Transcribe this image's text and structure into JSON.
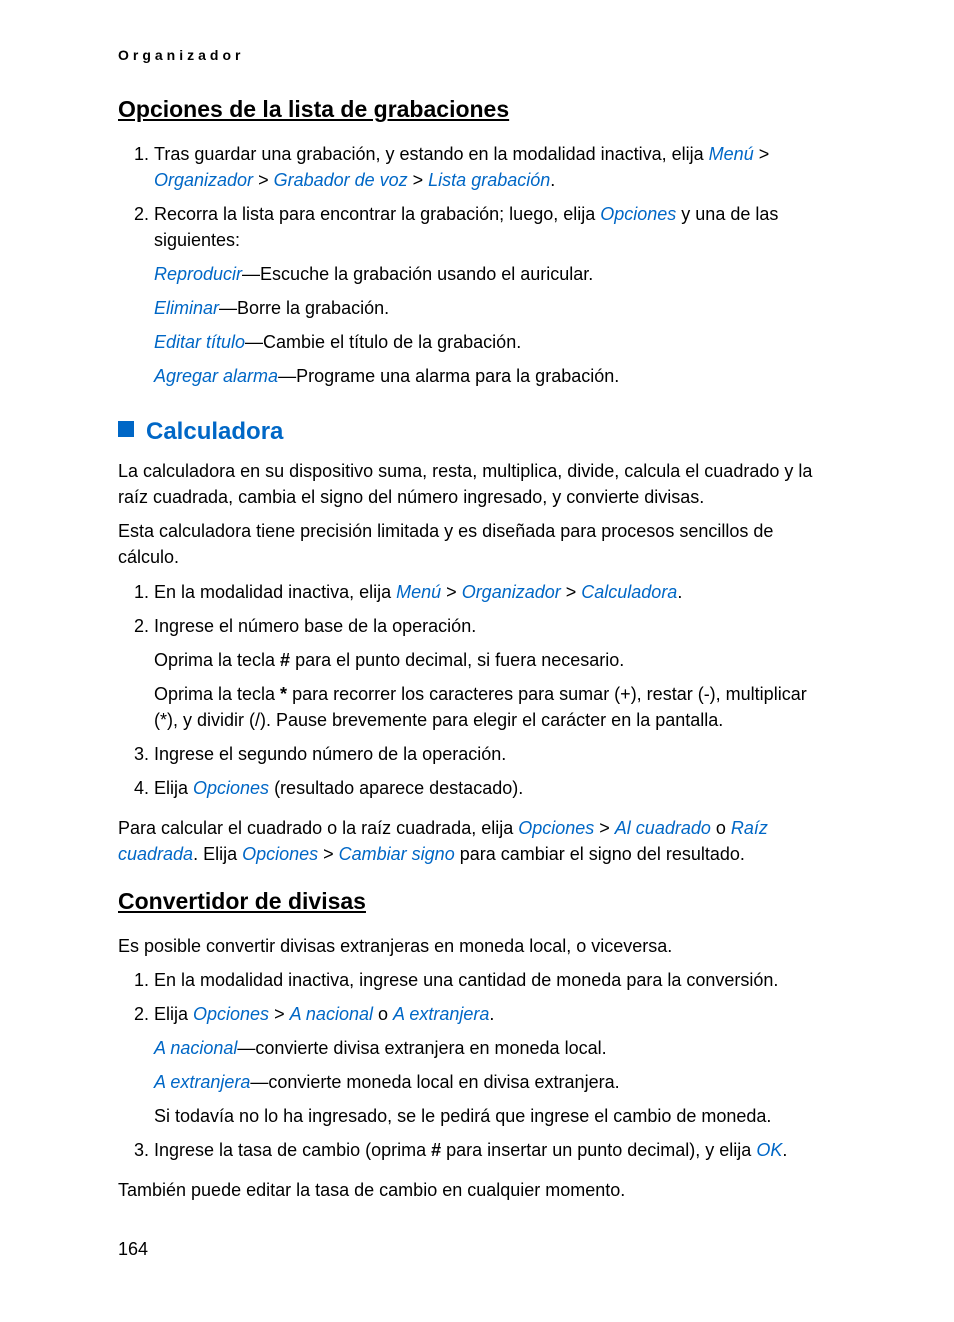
{
  "header": "Organizador",
  "sec1": {
    "title": "Opciones de la lista de grabaciones",
    "item1_a": "Tras guardar una grabación, y estando en la modalidad inactiva, elija ",
    "item1_menu": "Menú",
    "item1_gt1": " > ",
    "item1_org": "Organizador",
    "item1_gt2": " > ",
    "item1_grab": "Grabador de voz",
    "item1_gt3": " > ",
    "item1_lista": "Lista grabación",
    "item1_dot": ".",
    "item2_a": "Recorra la lista para encontrar la grabación; luego, elija ",
    "item2_opc": "Opciones",
    "item2_b": " y una de las siguientes:",
    "opt1_k": "Reproducir",
    "opt1_v": "—Escuche la grabación usando el auricular.",
    "opt2_k": "Eliminar",
    "opt2_v": "—Borre la grabación.",
    "opt3_k": "Editar título",
    "opt3_v": "—Cambie el título de la grabación.",
    "opt4_k": "Agregar alarma",
    "opt4_v": "—Programe una alarma para la grabación."
  },
  "sec2": {
    "title": "Calculadora",
    "intro1": "La calculadora en su dispositivo suma, resta, multiplica, divide, calcula el cuadrado y la raíz cuadrada, cambia el signo del número ingresado, y convierte divisas.",
    "intro2": "Esta calculadora tiene precisión limitada y es diseñada para procesos sencillos de cálculo.",
    "item1_a": "En la modalidad inactiva, elija ",
    "item1_menu": "Menú",
    "item1_gt1": " > ",
    "item1_org": "Organizador",
    "item1_gt2": " > ",
    "item1_calc": "Calculadora",
    "item1_dot": ".",
    "item2": "Ingrese el número base de la operación.",
    "item2_p1a": "Oprima la tecla ",
    "item2_p1b": "#",
    "item2_p1c": " para el punto decimal, si fuera necesario.",
    "item2_p2a": "Oprima la tecla ",
    "item2_p2b": "*",
    "item2_p2c": " para recorrer los caracteres para sumar (+), restar (-), multiplicar (*), y dividir (/). Pause brevemente para elegir el carácter en la pantalla.",
    "item3": "Ingrese el segundo número de la operación.",
    "item4_a": "Elija ",
    "item4_opc": "Opciones",
    "item4_b": " (resultado aparece destacado).",
    "after_a": "Para calcular el cuadrado o la raíz cuadrada, elija ",
    "after_opc1": "Opciones",
    "after_gt1": " > ",
    "after_cuad": "Al cuadrado",
    "after_o": " o ",
    "after_raiz": "Raíz cuadrada",
    "after_mid": ". Elija ",
    "after_opc2": "Opciones",
    "after_gt2": " > ",
    "after_signo": "Cambiar signo",
    "after_end": " para cambiar el signo del resultado."
  },
  "sec3": {
    "title": "Convertidor de divisas",
    "intro": "Es posible convertir divisas extranjeras en moneda local, o viceversa.",
    "item1": "En la modalidad inactiva, ingrese una cantidad de moneda para la conversión.",
    "item2_a": "Elija ",
    "item2_opc": "Opciones",
    "item2_gt": " > ",
    "item2_nac": "A nacional",
    "item2_o": " o ",
    "item2_ext": "A extranjera",
    "item2_dot": ".",
    "opt1_k": "A nacional",
    "opt1_v": "—convierte divisa extranjera en moneda local.",
    "opt2_k": "A extranjera",
    "opt2_v": "—convierte moneda local en divisa extranjera.",
    "item2_p3": "Si todavía no lo ha ingresado, se le pedirá que ingrese el cambio de moneda.",
    "item3_a": "Ingrese la tasa de cambio (oprima ",
    "item3_b": "#",
    "item3_c": " para insertar un punto decimal), y elija ",
    "item3_ok": "OK",
    "item3_dot": ".",
    "after": "También puede editar la tasa de cambio en cualquier momento."
  },
  "pageNumber": "164"
}
